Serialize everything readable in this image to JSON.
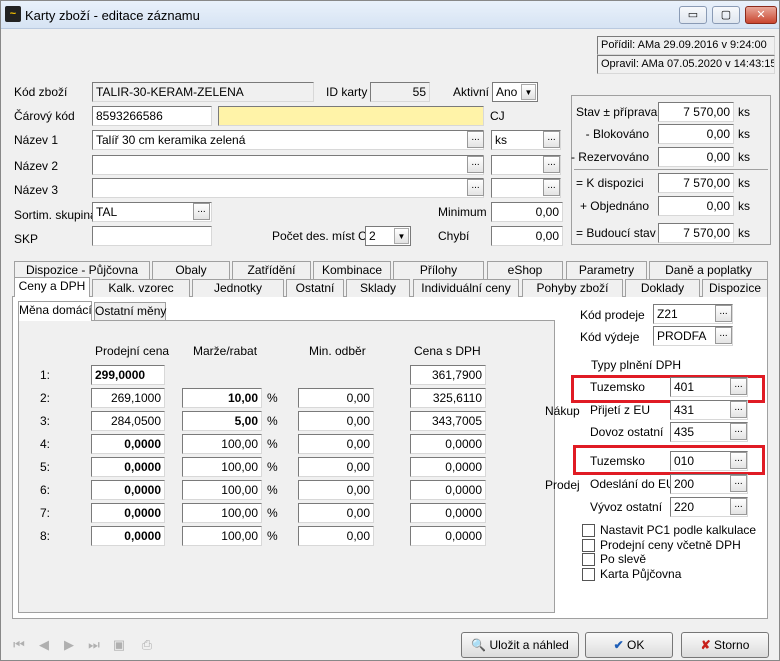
{
  "window": {
    "title": "Karty zboží - editace záznamu",
    "min": "▭",
    "max": "▢",
    "close": "✕"
  },
  "audit": {
    "created": "Pořídil: AMa 29.09.2016 v 9:24:00",
    "modified": "Opravil: AMa 07.05.2020 v 14:43:15"
  },
  "header": {
    "kod_label": "Kód zboží",
    "kod_value": "TALIR-30-KERAM-ZELENA",
    "id_label": "ID karty",
    "id_value": "55",
    "aktivni_label": "Aktivní",
    "aktivni_value": "Ano",
    "carovy_label": "Čárový kód",
    "carovy_value": "8593266586",
    "cj_label": "CJ",
    "nazev1_label": "Název 1",
    "nazev1_value": "Talíř 30 cm keramika zelená",
    "unit1": "ks",
    "nazev2_label": "Název 2",
    "nazev3_label": "Název 3",
    "sortim_label": "Sortim. skupina",
    "sortim_value": "TAL",
    "skp_label": "SKP",
    "pocet_label": "Počet des. míst CJ",
    "pocet_value": "2",
    "minimum_label": "Minimum",
    "minimum_value": "0,00",
    "chybi_label": "Chybí",
    "chybi_value": "0,00",
    "dots": "..."
  },
  "stock": [
    {
      "label": "Stav ± příprava",
      "value": "7 570,00",
      "unit": "ks"
    },
    {
      "label": "- Blokováno",
      "value": "0,00",
      "unit": "ks"
    },
    {
      "label": "- Rezervováno",
      "value": "0,00",
      "unit": "ks"
    },
    {
      "label": "= K dispozici",
      "value": "7 570,00",
      "unit": "ks"
    },
    {
      "label": "+ Objednáno",
      "value": "0,00",
      "unit": "ks"
    },
    {
      "label": "= Budoucí stav",
      "value": "7 570,00",
      "unit": "ks"
    }
  ],
  "tabs_row1": [
    "Dispozice - Půjčovna",
    "Obaly",
    "Zatřídění",
    "Kombinace",
    "Přílohy",
    "eShop",
    "Parametry",
    "Daně a poplatky"
  ],
  "tabs_row2": [
    "Ceny a DPH",
    "Kalk. vzorec",
    "Jednotky",
    "Ostatní",
    "Sklady",
    "Individuální ceny",
    "Pohyby zboží",
    "Doklady",
    "Dispozice"
  ],
  "subtabs": [
    "Měna domácí",
    "Ostatní měny"
  ],
  "price_table": {
    "headers": [
      "Prodejní cena",
      "Marže/rabat",
      "Min. odběr",
      "Cena s DPH"
    ],
    "percent": "%",
    "rows": [
      {
        "n": "1:",
        "price": "299,0000",
        "margin": "",
        "min": "",
        "vat": "361,7900"
      },
      {
        "n": "2:",
        "price": "269,1000",
        "margin": "10,00",
        "min": "0,00",
        "vat": "325,6110"
      },
      {
        "n": "3:",
        "price": "284,0500",
        "margin": "5,00",
        "min": "0,00",
        "vat": "343,7005"
      },
      {
        "n": "4:",
        "price": "0,0000",
        "margin": "100,00",
        "min": "0,00",
        "vat": "0,0000"
      },
      {
        "n": "5:",
        "price": "0,0000",
        "margin": "100,00",
        "min": "0,00",
        "vat": "0,0000"
      },
      {
        "n": "6:",
        "price": "0,0000",
        "margin": "100,00",
        "min": "0,00",
        "vat": "0,0000"
      },
      {
        "n": "7:",
        "price": "0,0000",
        "margin": "100,00",
        "min": "0,00",
        "vat": "0,0000"
      },
      {
        "n": "8:",
        "price": "0,0000",
        "margin": "100,00",
        "min": "0,00",
        "vat": "0,0000"
      }
    ]
  },
  "vat": {
    "kod_prodeje_label": "Kód prodeje",
    "kod_prodeje_value": "Z21",
    "kod_vydeje_label": "Kód výdeje",
    "kod_vydeje_value": "PRODFA",
    "typy_label": "Typy plnění DPH",
    "nakup_label": "Nákup",
    "prodej_label": "Prodej",
    "nakup": [
      {
        "label": "Tuzemsko",
        "value": "401"
      },
      {
        "label": "Přijetí z EU",
        "value": "431"
      },
      {
        "label": "Dovoz ostatní",
        "value": "435"
      }
    ],
    "prodej": [
      {
        "label": "Tuzemsko",
        "value": "010"
      },
      {
        "label": "Odeslání do EU",
        "value": "200"
      },
      {
        "label": "Vývoz ostatní",
        "value": "220"
      }
    ],
    "checks": [
      "Nastavit PC1 podle kalkulace",
      "Prodejní ceny včetně DPH",
      "Po slevě",
      "Karta Půjčovna"
    ]
  },
  "footer": {
    "save_preview": "Uložit a náhled",
    "ok": "OK",
    "cancel": "Storno"
  },
  "colors": {
    "highlight": "#e01b24",
    "input_yellow": "#fff3a8"
  }
}
